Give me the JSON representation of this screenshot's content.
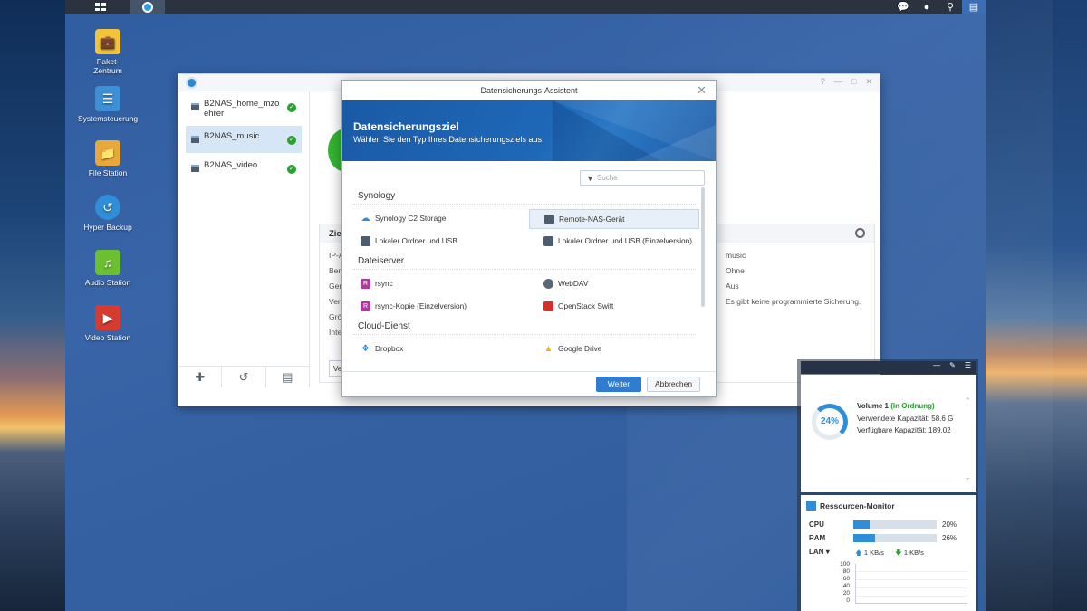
{
  "taskbar": {
    "right_icons": [
      "notification-icon",
      "user-icon",
      "search-icon",
      "widgets-icon"
    ]
  },
  "desktop": {
    "icons": [
      {
        "label": "Paket-\nZentrum",
        "icon": "package-icon"
      },
      {
        "label": "Systemsteuerung",
        "icon": "control-panel-icon"
      },
      {
        "label": "File Station",
        "icon": "folder-icon"
      },
      {
        "label": "Hyper Backup",
        "icon": "backup-icon"
      },
      {
        "label": "Audio Station",
        "icon": "music-icon"
      },
      {
        "label": "Video Station",
        "icon": "video-icon"
      }
    ]
  },
  "window": {
    "tasks": [
      {
        "label": "B2NAS_home_mzo ehrer"
      },
      {
        "label": "B2NAS_music"
      },
      {
        "label": "B2NAS_video"
      }
    ],
    "panel_title": "Ziel",
    "rows": [
      {
        "label": "IP-A",
        "value": "music"
      },
      {
        "label": "Ben",
        "value": "Ohne"
      },
      {
        "label": "Gen",
        "value": "Aus"
      },
      {
        "label": "Verz",
        "value": "Es gibt keine programmierte Sicherung."
      },
      {
        "label": "Grö",
        "value": ""
      },
      {
        "label": "Inte",
        "value": ""
      }
    ],
    "bottom_button": "Ve"
  },
  "dialog": {
    "title": "Datensicherungs-Assistent",
    "heading": "Datensicherungsziel",
    "subheading": "Wählen Sie den Typ Ihres Datensicherungsziels aus.",
    "search_placeholder": "Suche",
    "categories": [
      "Synology",
      "Dateiserver",
      "Cloud-Dienst"
    ],
    "options": [
      {
        "label": "Synology C2 Storage",
        "icon": "cloud-icon",
        "color": "#2e8ed8"
      },
      {
        "label": "Remote-NAS-Gerät",
        "icon": "nas-icon",
        "color": "#4c5d70",
        "selected": true
      },
      {
        "label": "Lokaler Ordner und USB",
        "icon": "local-folder-icon",
        "color": "#4c5d70"
      },
      {
        "label": "Lokaler Ordner und USB (Einzelversion)",
        "icon": "local-folder-single-icon",
        "color": "#4c5d70"
      },
      {
        "label": "rsync",
        "icon": "rsync-icon",
        "color": "#b0399f"
      },
      {
        "label": "WebDAV",
        "icon": "webdav-icon",
        "color": "#5a6876"
      },
      {
        "label": "rsync-Kopie (Einzelversion)",
        "icon": "rsync-copy-icon",
        "color": "#b0399f"
      },
      {
        "label": "OpenStack Swift",
        "icon": "openstack-icon",
        "color": "#d0312d"
      },
      {
        "label": "Dropbox",
        "icon": "dropbox-icon",
        "color": "#2e7fe0"
      },
      {
        "label": "Google Drive",
        "icon": "google-drive-icon",
        "color": "#f4b400"
      }
    ],
    "next_button": "Weiter",
    "cancel_button": "Abbrechen"
  },
  "storage_widget": {
    "percent": "24%",
    "volume_prefix": "Volume 1",
    "volume_status": "(In Ordnung)",
    "used": "Verwendete Kapazität: 58.6 G",
    "free": "Verfügbare Kapazität: 189.02"
  },
  "resource_monitor": {
    "title": "Ressourcen-Monitor",
    "cpu_label": "CPU",
    "cpu_value": "20%",
    "cpu_fraction": 0.2,
    "ram_label": "RAM",
    "ram_value": "26%",
    "ram_fraction": 0.26,
    "lan_label": "LAN",
    "upload": "1 KB/s",
    "download": "1 KB/s",
    "axis_ticks": [
      "100",
      "80",
      "60",
      "40",
      "20",
      "0"
    ]
  }
}
